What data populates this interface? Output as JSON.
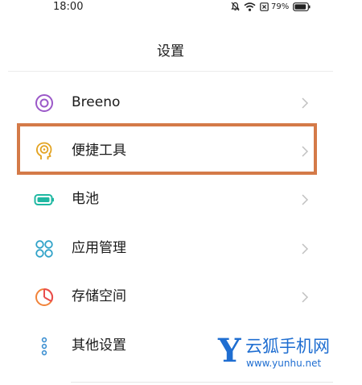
{
  "status_bar": {
    "time": "18:00",
    "battery_percent": "79%",
    "icons": [
      "bell-off-icon",
      "wifi-icon",
      "sim-x-icon",
      "battery-icon"
    ]
  },
  "header": {
    "title": "设置"
  },
  "menu": [
    {
      "label": "Breeno",
      "icon": "breeno-ring-icon",
      "icon_color": "#9b58c8"
    },
    {
      "label": "便捷工具",
      "icon": "tool-head-icon",
      "icon_color": "#e3a321",
      "highlighted": true
    },
    {
      "label": "电池",
      "icon": "battery-icon",
      "icon_color": "#1fb8a2"
    },
    {
      "label": "应用管理",
      "icon": "app-grid-icon",
      "icon_color": "#2fa2c8"
    },
    {
      "label": "存储空间",
      "icon": "storage-pie-icon",
      "icon_color": "#f1833a"
    },
    {
      "label": "其他设置",
      "icon": "more-dots-icon",
      "icon_color": "#3b8fd1"
    }
  ],
  "highlight_color": "#d47a48",
  "watermark": {
    "letter": "Y",
    "name": "云狐手机网",
    "url": "www.yunhu.net",
    "color": "#1f6ed1"
  }
}
